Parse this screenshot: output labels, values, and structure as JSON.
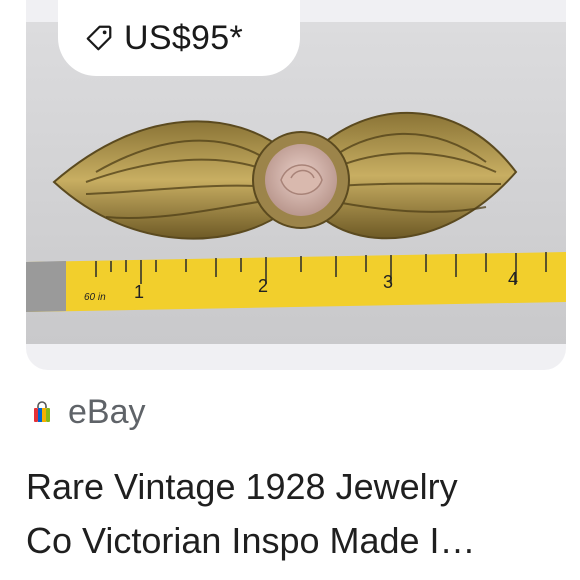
{
  "result": {
    "price": "US$95*",
    "image_alt": "Vintage gold-tone bow brooch with porcelain rose beside a measuring tape",
    "tape_numbers": [
      "1",
      "2",
      "3",
      "4"
    ],
    "tape_small_label": "60 in",
    "source": {
      "name": "eBay",
      "icon": "ebay-bag-icon"
    },
    "title_lines": [
      "Rare Vintage 1928 Jewelry",
      "Co Victorian Inspo Made I…"
    ]
  },
  "colors": {
    "card_bg": "#f0f0f3",
    "tape_yellow": "#f2cf2c",
    "text": "#1f1f1f",
    "source_text": "#5f6368"
  }
}
